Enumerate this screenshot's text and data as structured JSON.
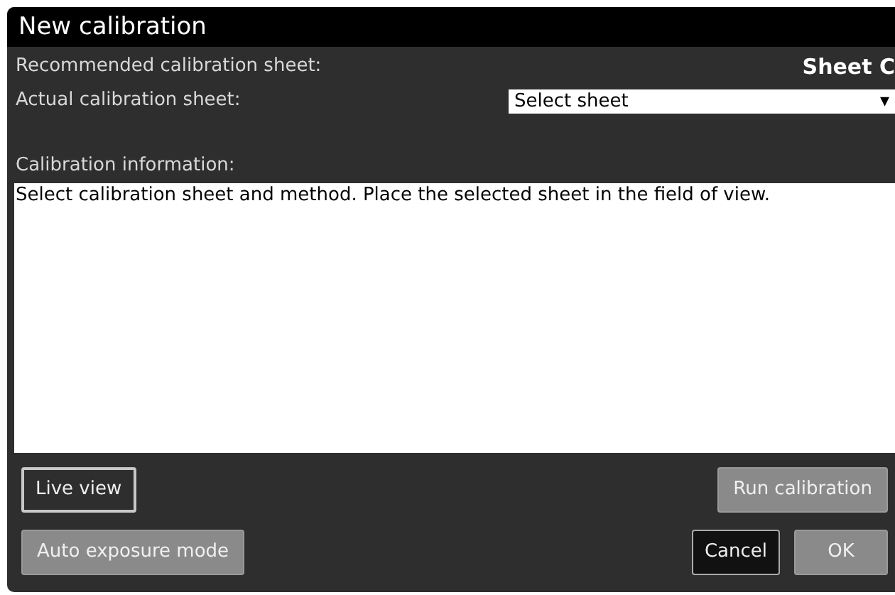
{
  "window": {
    "title": "New calibration"
  },
  "recommended": {
    "label": "Recommended calibration sheet:",
    "value": "Sheet C"
  },
  "actual": {
    "label": "Actual calibration sheet:",
    "value": "Select sheet",
    "arrow": "▾"
  },
  "info": {
    "label": "Calibration information:",
    "text": "Select calibration sheet and method. Place the selected sheet in the field of view."
  },
  "button_rows": [
    {
      "left": [
        {
          "label": "Live view",
          "kind": "outlined"
        }
      ],
      "right": [
        {
          "label": "Run calibration",
          "kind": "solid"
        }
      ]
    },
    {
      "left": [
        {
          "label": "Auto exposure mode",
          "kind": "solid"
        }
      ],
      "right": [
        {
          "label": "Cancel",
          "kind": "dark"
        },
        {
          "label": "OK",
          "kind": "solid"
        }
      ]
    }
  ]
}
